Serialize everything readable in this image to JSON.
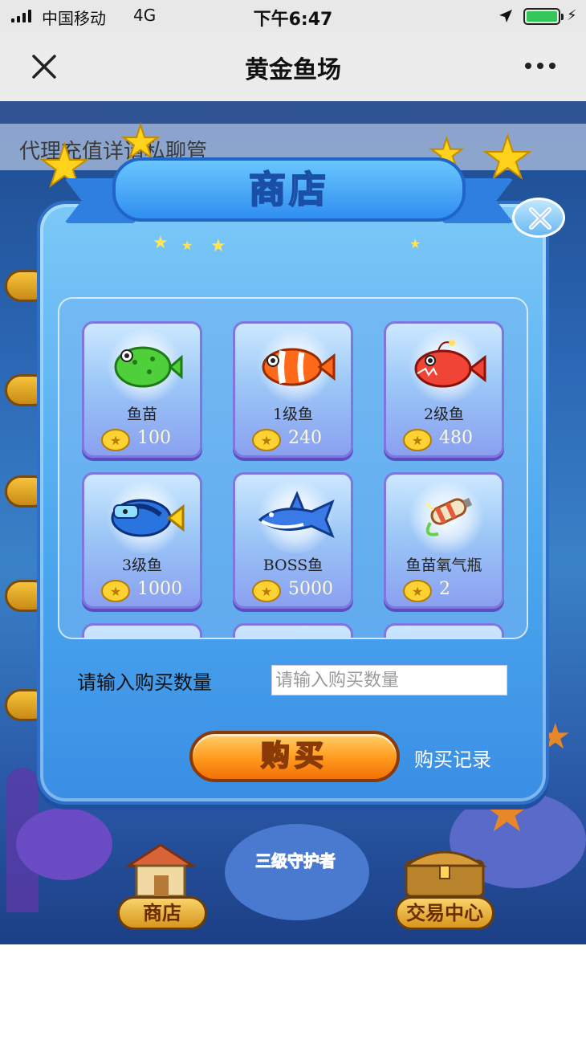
{
  "status_bar": {
    "carrier": "中国移动",
    "network": "4G",
    "time": "下午6:47"
  },
  "nav": {
    "title": "黄金鱼场",
    "close_icon": "close-icon",
    "more_icon": "more-icon"
  },
  "background": {
    "hint_text": "代理充值详请私聊管",
    "guard_label": "三级守护者",
    "bottom_buttons": {
      "shop": "商店",
      "trade_center": "交易中心"
    }
  },
  "shop": {
    "title": "商店",
    "items": [
      {
        "name": "鱼苗",
        "price": "100",
        "icon": "pufferfish-icon"
      },
      {
        "name": "1级鱼",
        "price": "240",
        "icon": "clownfish-icon"
      },
      {
        "name": "2级鱼",
        "price": "480",
        "icon": "anglerfish-icon"
      },
      {
        "name": "3级鱼",
        "price": "1000",
        "icon": "blue-tang-icon"
      },
      {
        "name": "BOSS鱼",
        "price": "5000",
        "icon": "shark-icon"
      },
      {
        "name": "鱼苗氧气瓶",
        "price": "2",
        "icon": "oxygen-bottle-icon"
      }
    ],
    "quantity_label": "请输入购买数量",
    "quantity_placeholder": "请输入购买数量",
    "quantity_value": "",
    "buy_label": "购买",
    "history_label": "购买记录"
  },
  "colors": {
    "modal": "#4aa6ee",
    "buy_button": "#ff9a1c",
    "card_border": "#7f76e0"
  }
}
